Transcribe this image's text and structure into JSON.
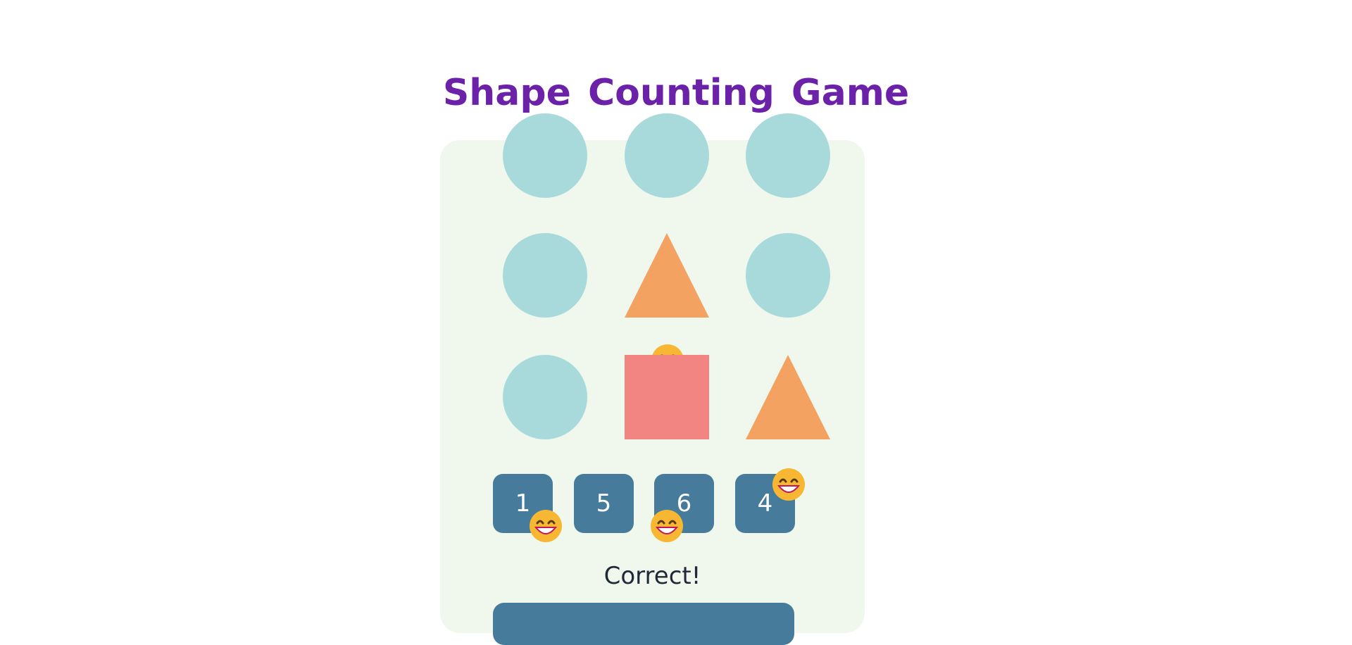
{
  "title": "Shape Counting Game",
  "colors": {
    "title": "#6b21a8",
    "panel_bg": "#f0f8ee",
    "circle": "#a8dadc",
    "triangle": "#f4a261",
    "square": "#f28482",
    "button": "#467b9c"
  },
  "grid": [
    [
      "circle",
      "circle",
      "circle"
    ],
    [
      "circle",
      "triangle",
      "circle"
    ],
    [
      "circle",
      "square",
      "triangle"
    ]
  ],
  "choices": [
    "1",
    "5",
    "6",
    "4"
  ],
  "feedback": "Correct!",
  "decoration_icon": "grinning-face-icon"
}
